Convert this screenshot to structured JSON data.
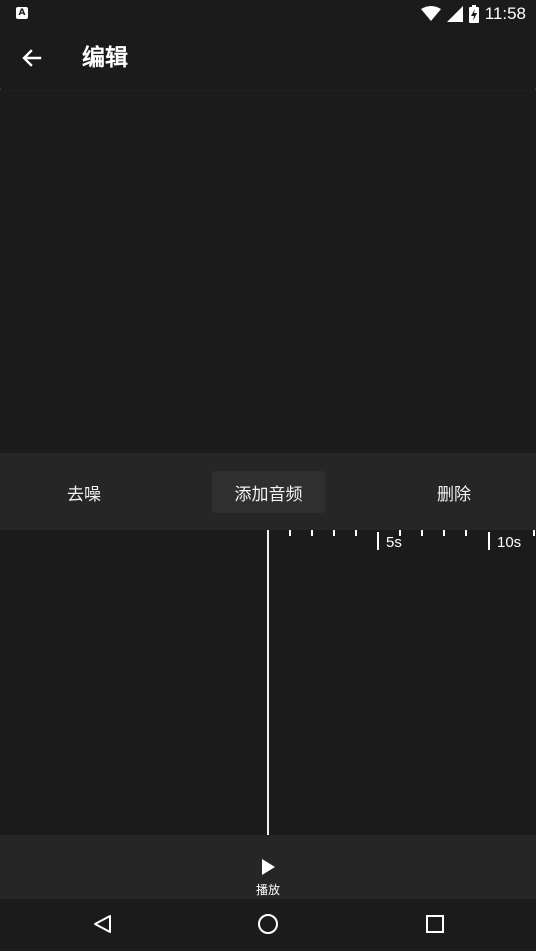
{
  "status_bar": {
    "notification_icon": "A",
    "time": "11:58",
    "icons": [
      "wifi-icon",
      "cell-signal-icon",
      "battery-charging-icon"
    ]
  },
  "app_bar": {
    "title": "编辑",
    "back_icon": "arrow-left"
  },
  "toolbar": {
    "denoise_label": "去噪",
    "add_audio_label": "添加音频",
    "delete_label": "删除",
    "active_item": "添加音频"
  },
  "timeline": {
    "tick_labels": [
      "5s",
      "10s"
    ],
    "playhead_seconds": 0
  },
  "player": {
    "play_label": "播放",
    "play_icon": "play-triangle"
  },
  "nav_bar": {
    "icons": [
      "back-triangle-icon",
      "home-circle-icon",
      "recents-square-icon"
    ]
  },
  "colors": {
    "background": "#1b1b1b",
    "panel": "#262626",
    "active_button": "#2f2f2f",
    "foreground": "#ffffff"
  }
}
